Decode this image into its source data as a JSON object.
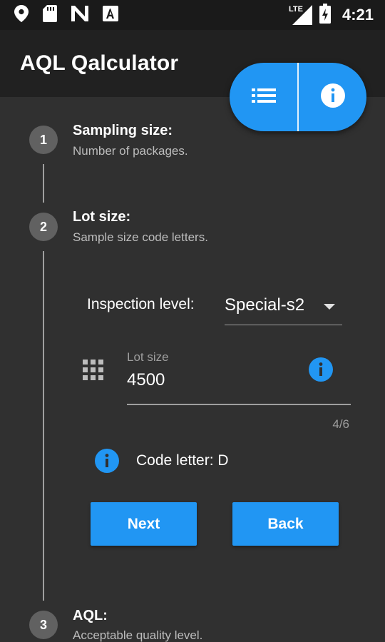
{
  "status_bar": {
    "time": "4:21",
    "network_label": "LTE",
    "icons": [
      "location-pin-icon",
      "sd-card-icon",
      "n-logo-icon",
      "a-box-icon",
      "signal-icon",
      "battery-charging-icon"
    ]
  },
  "app_bar": {
    "title": "AQL Qalculator"
  },
  "fab": {
    "left_icon": "list-icon",
    "right_icon": "info-icon",
    "color": "#2196f3"
  },
  "steps": [
    {
      "number": "1",
      "title": "Sampling size:",
      "subtitle": "Number of packages."
    },
    {
      "number": "2",
      "title": "Lot size:",
      "subtitle": "Sample size code letters."
    },
    {
      "number": "3",
      "title": "AQL:",
      "subtitle": "Acceptable quality level."
    }
  ],
  "form": {
    "inspection_label": "Inspection level:",
    "inspection_value": "Special-s2",
    "lot_size_label": "Lot size",
    "lot_size_value": "4500",
    "counter": "4/6",
    "code_letter": "Code letter: D"
  },
  "buttons": {
    "next": "Next",
    "back": "Back"
  },
  "colors": {
    "accent": "#2196f3",
    "background": "#303030",
    "app_bar": "#212121",
    "step_circle": "#616161"
  }
}
